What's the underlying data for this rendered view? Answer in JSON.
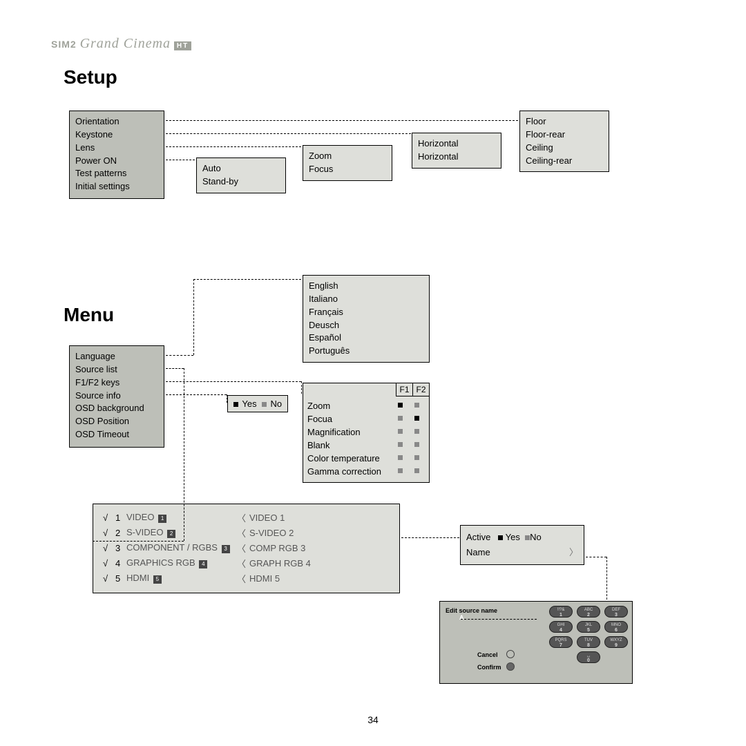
{
  "brand": {
    "sim2": "SIM2",
    "grand": "Grand Cinema",
    "ht": "HT"
  },
  "titles": {
    "setup": "Setup",
    "menu": "Menu"
  },
  "page_number": "34",
  "setup_main": {
    "items": [
      "Orientation",
      "Keystone",
      "Lens",
      "Power ON",
      "Test patterns",
      "Initial settings"
    ]
  },
  "power": {
    "items": [
      "Auto",
      "Stand-by"
    ]
  },
  "lens": {
    "items": [
      "Zoom",
      "Focus"
    ]
  },
  "keystone": {
    "items": [
      "Horizontal",
      "Horizontal"
    ]
  },
  "orientation": {
    "items": [
      "Floor",
      "Floor-rear",
      "Ceiling",
      "Ceiling-rear"
    ]
  },
  "menu_main": {
    "items": [
      "Language",
      "Source list",
      "F1/F2 keys",
      "Source info",
      "OSD background",
      "OSD Position",
      "OSD Timeout"
    ]
  },
  "languages": {
    "items": [
      "English",
      "Italiano",
      "Français",
      "Deusch",
      "Español",
      "Português"
    ]
  },
  "yesno": {
    "yes": "Yes",
    "no": "No"
  },
  "fkeys": {
    "headers": [
      "F1",
      "F2"
    ],
    "rows": [
      {
        "name": "Zoom",
        "f1": "black",
        "f2": "grey"
      },
      {
        "name": "Focua",
        "f1": "grey",
        "f2": "black"
      },
      {
        "name": "Magnification",
        "f1": "grey",
        "f2": "grey"
      },
      {
        "name": "Blank",
        "f1": "grey",
        "f2": "grey"
      },
      {
        "name": "Color temperature",
        "f1": "grey",
        "f2": "grey"
      },
      {
        "name": "Gamma correction",
        "f1": "grey",
        "f2": "grey"
      }
    ]
  },
  "sources": {
    "rows": [
      {
        "n": "1",
        "name": "VIDEO",
        "badge": "1",
        "alias": "VIDEO 1"
      },
      {
        "n": "2",
        "name": "S-VIDEO",
        "badge": "2",
        "alias": "S-VIDEO 2"
      },
      {
        "n": "3",
        "name": "COMPONENT / RGBS",
        "badge": "3",
        "alias": "COMP RGB 3"
      },
      {
        "n": "4",
        "name": "GRAPHICS RGB",
        "badge": "4",
        "alias": "GRAPH RGB 4"
      },
      {
        "n": "5",
        "name": "HDMI",
        "badge": "5",
        "alias": "HDMI 5"
      }
    ]
  },
  "active_box": {
    "active": "Active",
    "yes": "Yes",
    "no": "No",
    "name": "Name"
  },
  "keypad": {
    "title": "Edit source name",
    "cancel": "Cancel",
    "confirm": "Confirm",
    "keys": [
      {
        "let": "!!?&",
        "num": "1"
      },
      {
        "let": "ABC",
        "num": "2"
      },
      {
        "let": "DEF",
        "num": "3"
      },
      {
        "let": "GHI",
        "num": "4"
      },
      {
        "let": "JKL",
        "num": "5"
      },
      {
        "let": "MNO",
        "num": "6"
      },
      {
        "let": "PQRS",
        "num": "7"
      },
      {
        "let": "TUV",
        "num": "8"
      },
      {
        "let": "WXYZ",
        "num": "9"
      },
      {
        "let": "␣",
        "num": "0"
      }
    ]
  }
}
